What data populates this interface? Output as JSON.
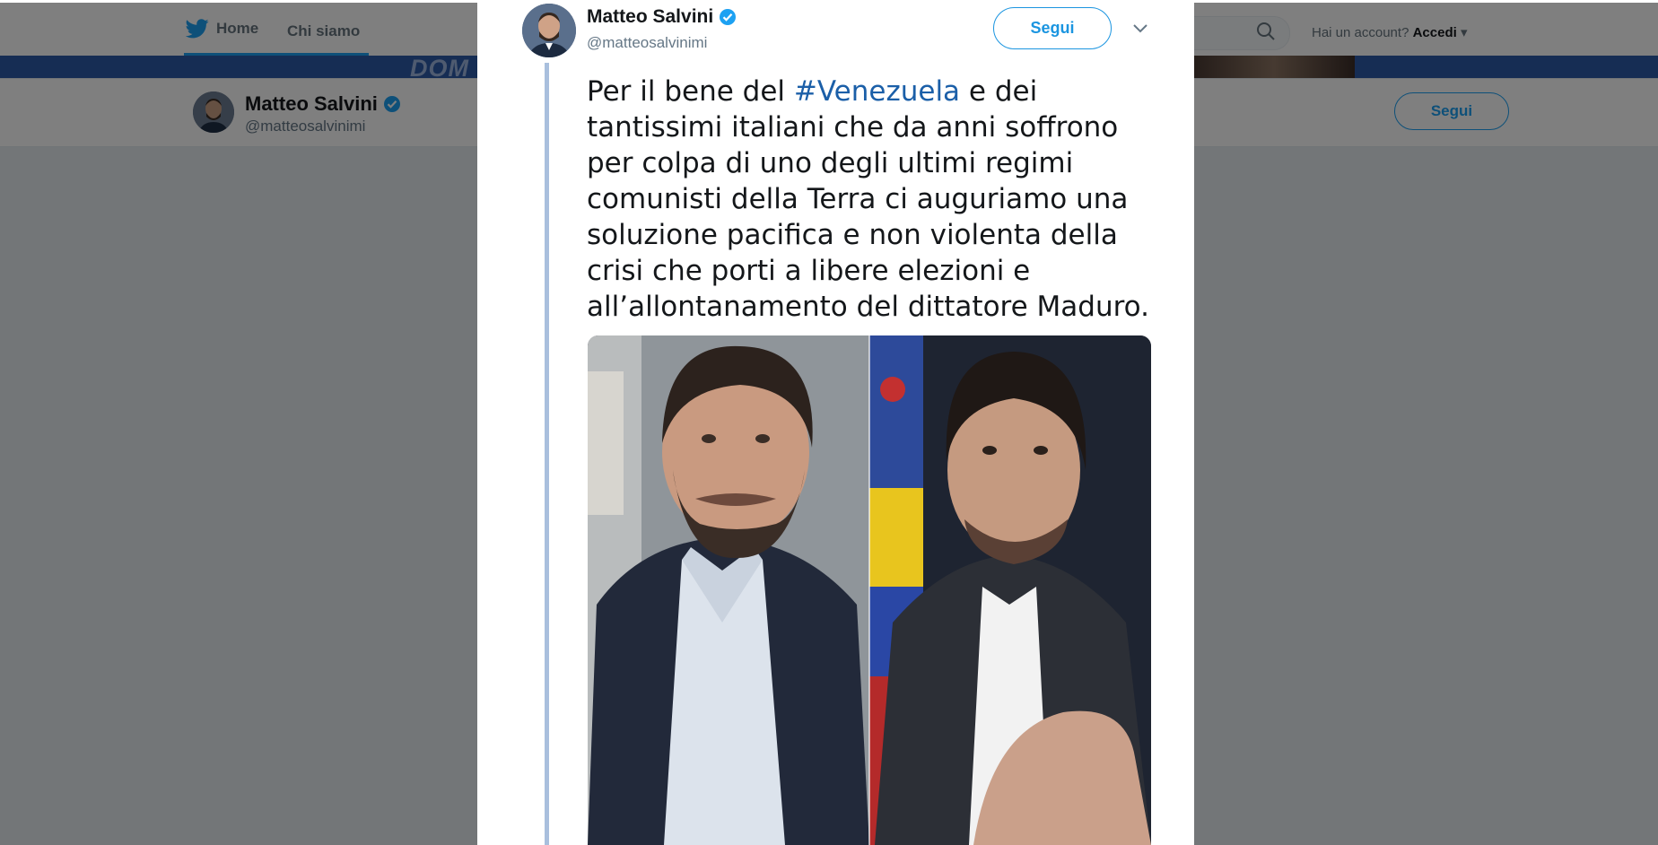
{
  "nav": {
    "home_label": "Home",
    "about_label": "Chi siamo",
    "login_prompt": "Hai un account?",
    "login_label": "Accedi"
  },
  "banner": {
    "text": "DOM"
  },
  "profile": {
    "name": "Matteo Salvini",
    "handle": "@matteosalvinimi",
    "follow_label": "Segui"
  },
  "tweet": {
    "author_name": "Matteo Salvini",
    "author_handle": "@matteosalvinimi",
    "follow_label": "Segui",
    "text_before": "Per il bene del ",
    "hashtag": "#Venezuela",
    "text_after": " e dei tantissimi italiani che da anni soffrono per colpa di uno degli ultimi regimi comunisti della Terra ci auguriamo una soluzione pacifica e non violenta della crisi che porti a libere elezioni e all’allontanamento del dittatore Maduro."
  },
  "colors": {
    "brand": "#1da1f2",
    "follow_button": "#1b95e0",
    "hashtag": "#1b5fa8",
    "banner": "#2c5aa8",
    "thread_line": "#a9bfdd"
  },
  "icons": [
    "twitter-bird-icon",
    "verified-badge-icon",
    "search-icon",
    "chevron-down-icon",
    "caret-down-icon"
  ]
}
